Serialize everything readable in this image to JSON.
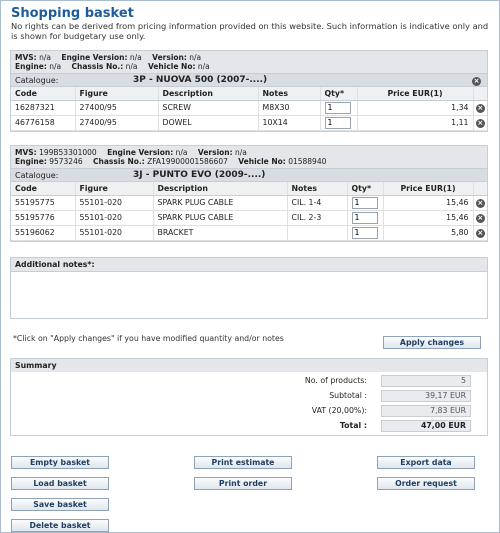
{
  "page": {
    "title": "Shopping basket",
    "disclaimer": "No rights can be derived from pricing information provided on this website. Such information is indicative only and is shown for budgetary use only."
  },
  "vehicle1": {
    "mvs_label": "MVS:",
    "mvs": "n/a",
    "engine_version_label": "Engine Version:",
    "engine_version": "n/a",
    "version_label": "Version:",
    "version": "n/a",
    "engine_label": "Engine:",
    "engine": "n/a",
    "chassis_label": "Chassis No.:",
    "chassis": "n/a",
    "vehicle_label": "Vehicle No:",
    "vehicle": "n/a",
    "catalogue_label": "Catalogue:",
    "catalogue": "3P - NUOVA 500 (2007-....)",
    "headers": [
      "Code",
      "Figure",
      "Description",
      "Notes",
      "Qty*",
      "Price EUR(1)"
    ],
    "rows": [
      {
        "code": "16287321",
        "figure": "27400/95",
        "description": "SCREW",
        "notes": "M8X30",
        "qty": "1",
        "price": "1,34"
      },
      {
        "code": "46776158",
        "figure": "27400/95",
        "description": "DOWEL",
        "notes": "10X14",
        "qty": "1",
        "price": "1,11"
      }
    ]
  },
  "vehicle2": {
    "mvs_label": "MVS:",
    "mvs": "199B53301000",
    "engine_version_label": "Engine Version:",
    "engine_version": "n/a",
    "version_label": "Version:",
    "version": "n/a",
    "engine_label": "Engine:",
    "engine": "9573246",
    "chassis_label": "Chassis No.:",
    "chassis": "ZFA19900001586607",
    "vehicle_label": "Vehicle No:",
    "vehicle": "01588940",
    "catalogue_label": "Catalogue:",
    "catalogue": "3J - PUNTO EVO (2009-....)",
    "headers": [
      "Code",
      "Figure",
      "Description",
      "Notes",
      "Qty*",
      "Price EUR(1)"
    ],
    "rows": [
      {
        "code": "55195775",
        "figure": "55101-020",
        "description": "SPARK PLUG CABLE",
        "notes": "CIL. 1-4",
        "qty": "1",
        "price": "15,46"
      },
      {
        "code": "55195776",
        "figure": "55101-020",
        "description": "SPARK PLUG CABLE",
        "notes": "CIL. 2-3",
        "qty": "1",
        "price": "15,46"
      },
      {
        "code": "55196062",
        "figure": "55101-020",
        "description": "BRACKET",
        "notes": "",
        "qty": "1",
        "price": "5,80"
      }
    ]
  },
  "notes": {
    "label": "Additional notes*:",
    "value": ""
  },
  "hint": "*Click on \"Apply changes\" if you have modified quantity and/or notes",
  "buttons": {
    "apply": "Apply changes",
    "empty": "Empty basket",
    "print_estimate": "Print estimate",
    "export": "Export data",
    "load": "Load basket",
    "print_order": "Print order",
    "order_request": "Order request",
    "save": "Save basket",
    "delete": "Delete basket"
  },
  "summary": {
    "title": "Summary",
    "products_label": "No. of products:",
    "products": "5",
    "subtotal_label": "Subtotal :",
    "subtotal": "39,17 EUR",
    "vat_label": "VAT (20,00%):",
    "vat": "7,83 EUR",
    "total_label": "Total :",
    "total": "47,00 EUR"
  },
  "icons": {
    "remove": "remove-circle-icon"
  }
}
